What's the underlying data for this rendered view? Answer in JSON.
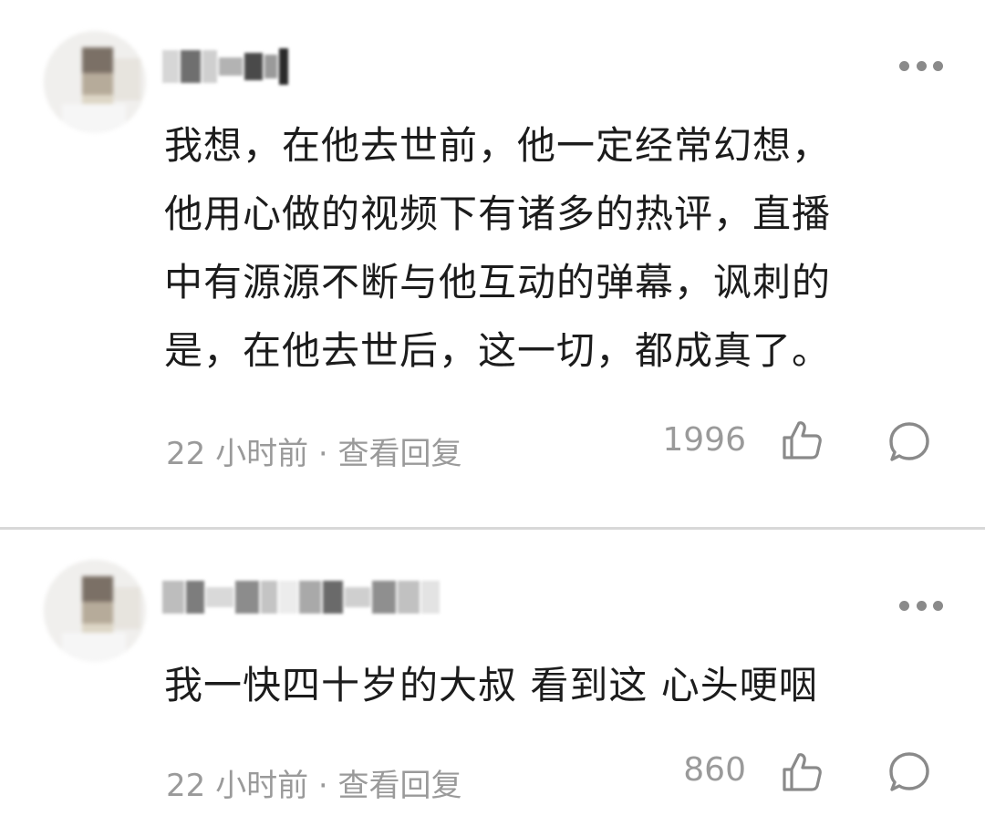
{
  "comments": [
    {
      "text": "我想，在他去世前，他一定经常幻想，\n他用心做的视频下有诸多的热评，直播\n中有源源不断与他互动的弹幕，讽刺的\n是，在他去世后，这一切，都成真了。",
      "time": "22 小时前",
      "separator": " · ",
      "reply_label": "查看回复",
      "likes": "1996"
    },
    {
      "text": "我一快四十岁的大叔 看到这 心头哽咽",
      "time": "22 小时前",
      "separator": " · ",
      "reply_label": "查看回复",
      "likes": "860"
    }
  ],
  "icons": {
    "more": "more-dots-icon",
    "like": "thumbs-up-icon",
    "reply": "comment-bubble-icon"
  },
  "colors": {
    "text": "#1c1c1c",
    "meta": "#9a9a9a",
    "icon": "#8a8a8a",
    "divider": "#d8d8d8"
  }
}
